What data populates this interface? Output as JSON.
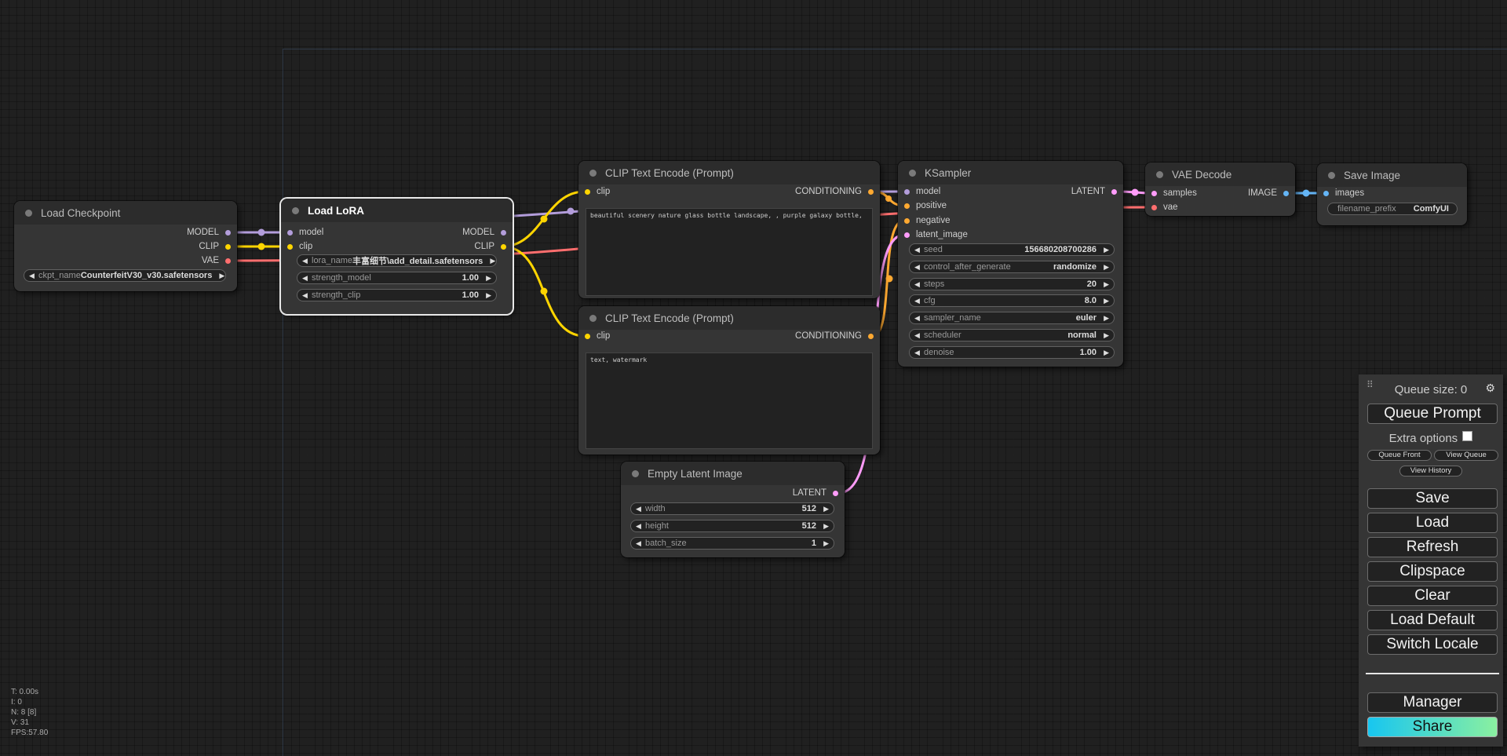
{
  "nodes": {
    "load_checkpoint": {
      "title": "Load Checkpoint",
      "outputs": [
        "MODEL",
        "CLIP",
        "VAE"
      ],
      "ckpt_label": "ckpt_name",
      "ckpt_value": "CounterfeitV30_v30.safetensors"
    },
    "load_lora": {
      "title": "Load LoRA",
      "inputs": [
        "model",
        "clip"
      ],
      "outputs": [
        "MODEL",
        "CLIP"
      ],
      "lora_label": "lora_name",
      "lora_value": "丰富细节\\add_detail.safetensors",
      "strength_model_label": "strength_model",
      "strength_model_value": "1.00",
      "strength_clip_label": "strength_clip",
      "strength_clip_value": "1.00"
    },
    "clip_pos": {
      "title": "CLIP Text Encode (Prompt)",
      "input": "clip",
      "output": "CONDITIONING",
      "text": "beautiful scenery nature glass bottle landscape, , purple galaxy bottle,"
    },
    "clip_neg": {
      "title": "CLIP Text Encode (Prompt)",
      "input": "clip",
      "output": "CONDITIONING",
      "text": "text, watermark"
    },
    "ksampler": {
      "title": "KSampler",
      "inputs": [
        "model",
        "positive",
        "negative",
        "latent_image"
      ],
      "output": "LATENT",
      "widgets": [
        {
          "label": "seed",
          "value": "156680208700286"
        },
        {
          "label": "control_after_generate",
          "value": "randomize"
        },
        {
          "label": "steps",
          "value": "20"
        },
        {
          "label": "cfg",
          "value": "8.0"
        },
        {
          "label": "sampler_name",
          "value": "euler"
        },
        {
          "label": "scheduler",
          "value": "normal"
        },
        {
          "label": "denoise",
          "value": "1.00"
        }
      ]
    },
    "vae_decode": {
      "title": "VAE Decode",
      "inputs": [
        "samples",
        "vae"
      ],
      "output": "IMAGE"
    },
    "save_image": {
      "title": "Save Image",
      "input": "images",
      "prefix_label": "filename_prefix",
      "prefix_value": "ComfyUI"
    },
    "empty_latent": {
      "title": "Empty Latent Image",
      "output": "LATENT",
      "widgets": [
        {
          "label": "width",
          "value": "512"
        },
        {
          "label": "height",
          "value": "512"
        },
        {
          "label": "batch_size",
          "value": "1"
        }
      ]
    }
  },
  "stats": {
    "t": "T: 0.00s",
    "i": "I: 0",
    "n": "N: 8 [8]",
    "v": "V: 31",
    "fps": "FPS:57.80"
  },
  "menu": {
    "queue_size": "Queue size: 0",
    "queue_prompt": "Queue Prompt",
    "extra_options": "Extra options",
    "queue_front": "Queue Front",
    "view_queue": "View Queue",
    "view_history": "View History",
    "save": "Save",
    "load": "Load",
    "refresh": "Refresh",
    "clipspace": "Clipspace",
    "clear": "Clear",
    "load_default": "Load Default",
    "switch_locale": "Switch Locale",
    "manager": "Manager",
    "share": "Share"
  },
  "colors": {
    "model": "#b39ddb",
    "clip": "#ffd500",
    "vae": "#ff6e6e",
    "conditioning": "#ffa931",
    "latent": "#ff9cf9",
    "image": "#64b5f6"
  }
}
